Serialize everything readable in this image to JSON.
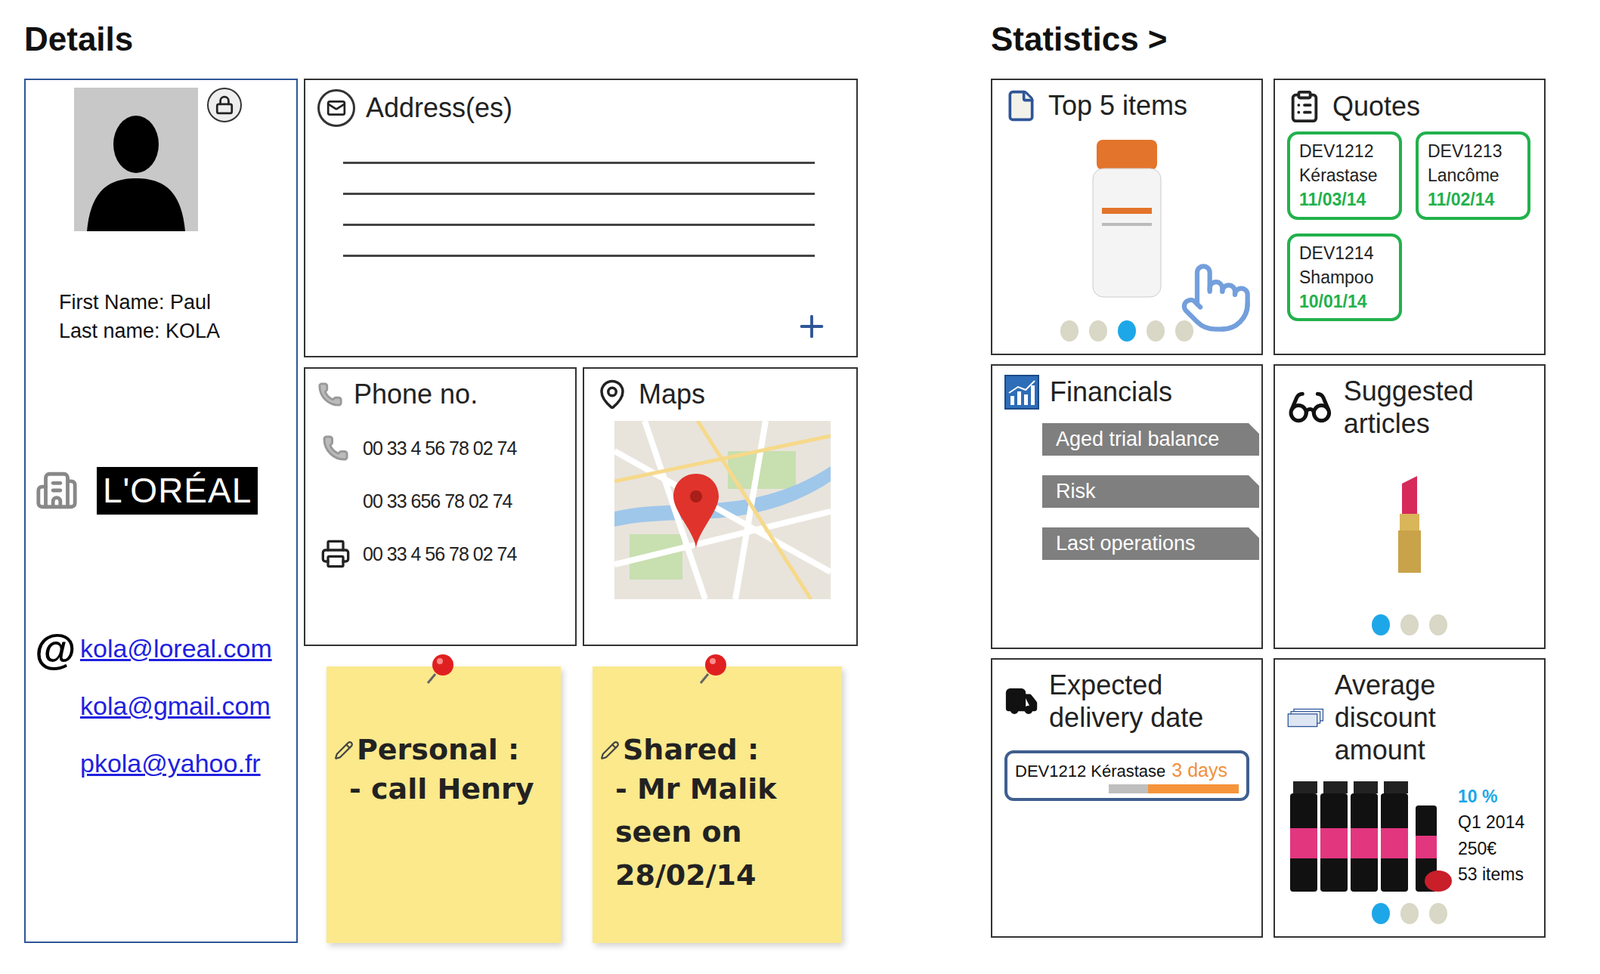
{
  "details": {
    "title": "Details",
    "first_name": "First Name: Paul",
    "last_name": "Last name: KOLA",
    "company": "L'ORÉAL",
    "email_icon": "@",
    "emails": [
      "kola@loreal.com",
      "kola@gmail.com",
      "pkola@yahoo.fr"
    ]
  },
  "address": {
    "title": "Address(es)",
    "lines": [
      "",
      "",
      "",
      ""
    ]
  },
  "phone": {
    "title": "Phone no.",
    "numbers": [
      {
        "kind": "phone",
        "number": "00 33 4 56 78 02 74"
      },
      {
        "kind": "plain",
        "number": "00 33 656 78 02 74"
      },
      {
        "kind": "fax",
        "number": "00 33 4 56 78 02 74"
      }
    ]
  },
  "map": {
    "title": "Maps"
  },
  "notes": [
    {
      "title": "Personal :",
      "lines": [
        "- call Henry"
      ]
    },
    {
      "title": "Shared :",
      "lines": [
        "- Mr Malik",
        "seen on",
        "28/02/14"
      ]
    }
  ],
  "statistics": {
    "title": "Statistics >"
  },
  "top_items": {
    "title": "Top 5 items",
    "dots": [
      {
        "selected": false
      },
      {
        "selected": false
      },
      {
        "selected": true
      },
      {
        "selected": false
      },
      {
        "selected": false
      }
    ]
  },
  "quotes": {
    "title": "Quotes",
    "items": [
      {
        "id": "DEV1212",
        "brand": "Kérastase",
        "date": "11/03/14"
      },
      {
        "id": "DEV1213",
        "brand": "Lancôme",
        "date": "11/02/14"
      },
      {
        "id": "DEV1214",
        "brand": "Shampoo",
        "date": "10/01/14"
      }
    ]
  },
  "financials": {
    "title": "Financials",
    "buttons": [
      "Aged trial balance",
      "Risk",
      "Last operations"
    ]
  },
  "suggested": {
    "title": "Suggested articles",
    "dots": [
      {
        "selected": true
      },
      {
        "selected": false
      },
      {
        "selected": false
      }
    ]
  },
  "delivery": {
    "title": "Expected delivery date",
    "items": [
      {
        "label": "DEV1212 Kérastase",
        "remaining": "3 days",
        "level": 0.3
      }
    ]
  },
  "discount": {
    "title": "Average discount amount",
    "rate": "10 %",
    "period": "Q1 2014",
    "amount": "250€",
    "count": "53 items",
    "dots": [
      {
        "selected": true
      },
      {
        "selected": false
      },
      {
        "selected": false
      }
    ]
  }
}
